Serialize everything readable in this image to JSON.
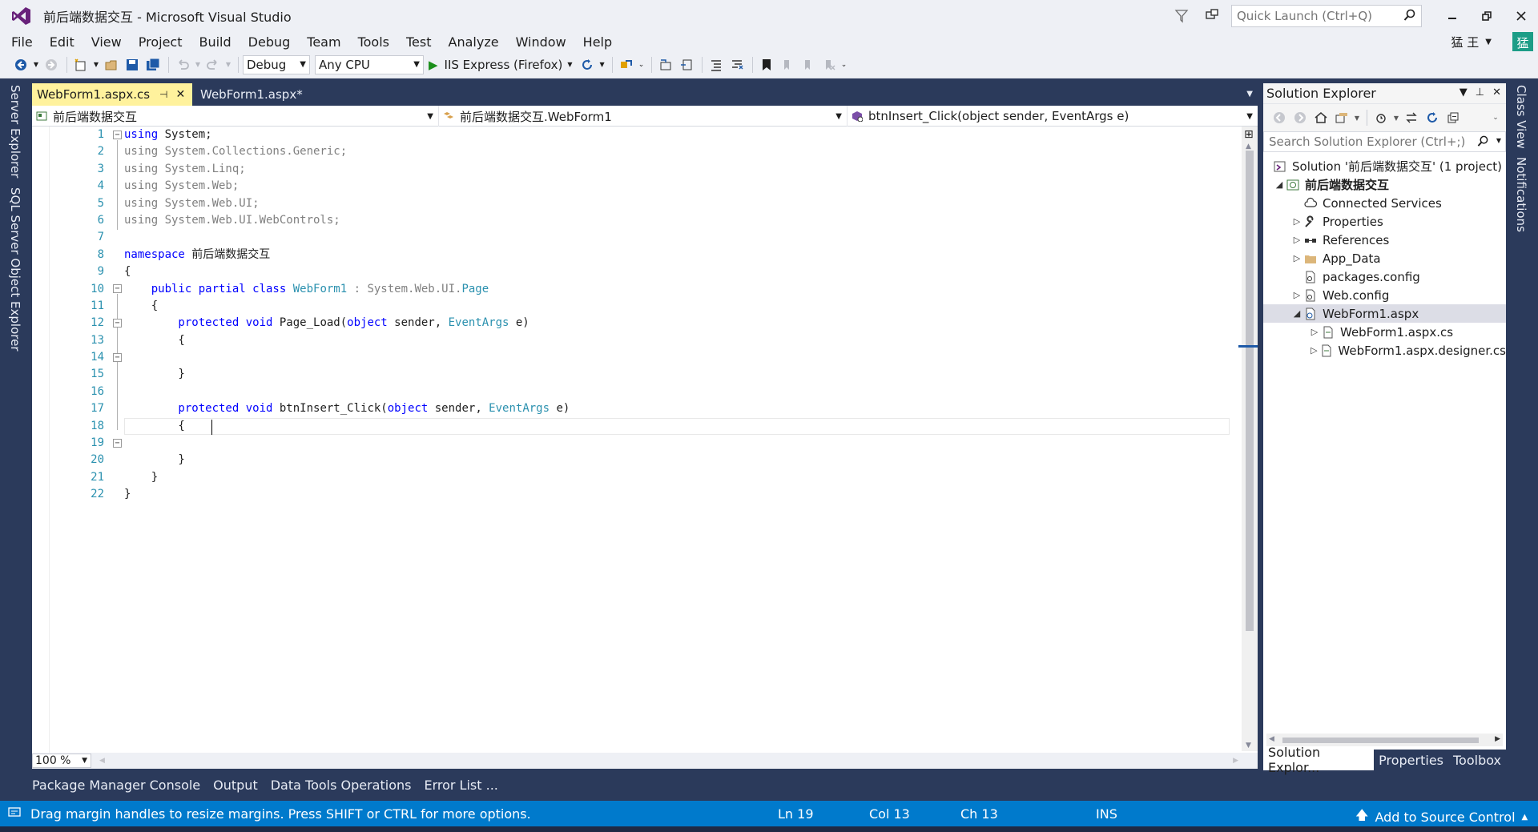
{
  "window": {
    "title": "前后端数据交互 - Microsoft Visual Studio",
    "quick_launch_placeholder": "Quick Launch (Ctrl+Q)"
  },
  "menu": [
    "File",
    "Edit",
    "View",
    "Project",
    "Build",
    "Debug",
    "Team",
    "Tools",
    "Test",
    "Analyze",
    "Window",
    "Help"
  ],
  "account": {
    "name": "猛 王",
    "avatar_letter": "猛"
  },
  "toolbar": {
    "configuration": "Debug",
    "platform": "Any CPU",
    "run_target": "IIS Express (Firefox)"
  },
  "left_sidebar": [
    "Server Explorer",
    "SQL Server Object Explorer"
  ],
  "right_sidebar": [
    "Class View",
    "Notifications"
  ],
  "doc_tabs": [
    {
      "label": "WebForm1.aspx.cs",
      "active": true
    },
    {
      "label": "WebForm1.aspx*",
      "active": false
    }
  ],
  "nav_bar": {
    "project": "前后端数据交互",
    "class": "前后端数据交互.WebForm1",
    "member": "btnInsert_Click(object sender, EventArgs e)"
  },
  "code_lines": [
    {
      "n": "1"
    },
    {
      "n": "2"
    },
    {
      "n": "3"
    },
    {
      "n": "4"
    },
    {
      "n": "5"
    },
    {
      "n": "6"
    },
    {
      "n": "7"
    },
    {
      "n": "8"
    },
    {
      "n": "9"
    },
    {
      "n": "10"
    },
    {
      "n": "11"
    },
    {
      "n": "12"
    },
    {
      "n": "13"
    },
    {
      "n": "14"
    },
    {
      "n": "15"
    },
    {
      "n": "16"
    },
    {
      "n": "17"
    },
    {
      "n": "18"
    },
    {
      "n": "19"
    },
    {
      "n": "20"
    },
    {
      "n": "21"
    },
    {
      "n": "22"
    }
  ],
  "code": {
    "l1_kw": "using",
    "l1_rest": " System;",
    "l2": "using System.Collections.Generic;",
    "l3": "using System.Linq;",
    "l4": "using System.Web;",
    "l5": "using System.Web.UI;",
    "l6": "using System.Web.UI.WebControls;",
    "l8_kw": "namespace",
    "l8_rest": " 前后端数据交互",
    "l9": "{",
    "l10_kw": "    public partial class",
    "l10_ty": " WebForm1",
    "l10_rest": " : System.Web.UI.",
    "l10_ty2": "Page",
    "l11": "    {",
    "l12_kw1": "        protected void",
    "l12_a": " Page_Load(",
    "l12_kw2": "object",
    "l12_b": " sender, ",
    "l12_ty": "EventArgs",
    "l12_c": " e)",
    "l13": "        {",
    "l15": "        }",
    "l17_kw1": "        protected void",
    "l17_a": " btnInsert_Click(",
    "l17_kw2": "object",
    "l17_b": " sender, ",
    "l17_ty": "EventArgs",
    "l17_c": " e)",
    "l18": "        {",
    "l20": "        }",
    "l21": "    }",
    "l22": "}"
  },
  "zoom": "100 %",
  "bottom_tabs": [
    "Package Manager Console",
    "Output",
    "Data Tools Operations",
    "Error List ..."
  ],
  "solution_explorer": {
    "title": "Solution Explorer",
    "search_placeholder": "Search Solution Explorer (Ctrl+;)",
    "nodes": [
      {
        "label": "Solution '前后端数据交互' (1 project)",
        "level": 0,
        "expander": "",
        "icon": "solution-icon"
      },
      {
        "label": "前后端数据交互",
        "level": 0,
        "expander": "◢",
        "icon": "web-project-icon",
        "bold": true
      },
      {
        "label": "Connected Services",
        "level": 1,
        "expander": "",
        "icon": "connected-services-icon"
      },
      {
        "label": "Properties",
        "level": 1,
        "expander": "▷",
        "icon": "wrench-icon"
      },
      {
        "label": "References",
        "level": 1,
        "expander": "▷",
        "icon": "references-icon"
      },
      {
        "label": "App_Data",
        "level": 1,
        "expander": "▷",
        "icon": "folder-icon"
      },
      {
        "label": "packages.config",
        "level": 1,
        "expander": "",
        "icon": "config-icon"
      },
      {
        "label": "Web.config",
        "level": 1,
        "expander": "▷",
        "icon": "config-icon"
      },
      {
        "label": "WebForm1.aspx",
        "level": 1,
        "expander": "◢",
        "icon": "aspx-icon",
        "selected": true
      },
      {
        "label": "WebForm1.aspx.cs",
        "level": 2,
        "expander": "▷",
        "icon": "cs-file-icon"
      },
      {
        "label": "WebForm1.aspx.designer.cs",
        "level": 2,
        "expander": "▷",
        "icon": "cs-file-icon"
      }
    ],
    "tabs": [
      "Solution Explor...",
      "Properties",
      "Toolbox"
    ]
  },
  "status": {
    "message": "Drag margin handles to resize margins. Press SHIFT or CTRL for more options.",
    "ln": "Ln 19",
    "col": "Col 13",
    "ch": "Ch 13",
    "mode": "INS",
    "source_control": "Add to Source Control"
  },
  "colors": {
    "accent": "#007acc",
    "frame": "#2b3a5b",
    "active_tab": "#fff29d",
    "keyword": "#0000ff",
    "type": "#2b91af"
  }
}
